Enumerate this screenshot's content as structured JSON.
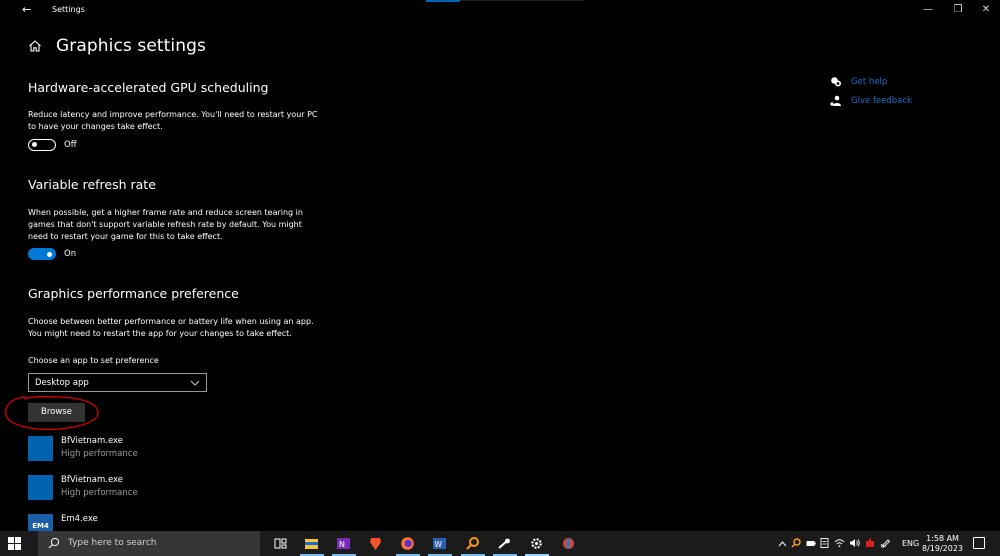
{
  "window": {
    "back_glyph": "←",
    "title": "Settings",
    "controls": {
      "minimize": "—",
      "maximize": "❐",
      "close": "✕"
    }
  },
  "page": {
    "title": "Graphics settings",
    "home_icon": "home-icon"
  },
  "gpu_scheduling": {
    "title": "Hardware-accelerated GPU scheduling",
    "description": "Reduce latency and improve performance. You'll need to restart your PC to have your changes take effect.",
    "toggle_state": "off",
    "toggle_label": "Off"
  },
  "variable_refresh": {
    "title": "Variable refresh rate",
    "description": "When possible, get a higher frame rate and reduce screen tearing in games that don't support variable refresh rate by default. You might need to restart your game for this to take effect.",
    "toggle_state": "on",
    "toggle_label": "On"
  },
  "performance_pref": {
    "title": "Graphics performance preference",
    "description": "Choose between better performance or battery life when using an app. You might need to restart the app for your changes to take effect.",
    "choose_label": "Choose an app to set preference",
    "dropdown_value": "Desktop app",
    "browse_label": "Browse",
    "apps": [
      {
        "name": "BfVietnam.exe",
        "preference": "High performance",
        "icon": "app-icon"
      },
      {
        "name": "BfVietnam.exe",
        "preference": "High performance",
        "icon": "app-icon"
      },
      {
        "name": "Em4.exe",
        "preference": "",
        "icon": "em4-icon",
        "icon_text": "EM4"
      }
    ]
  },
  "help_links": {
    "get_help": "Get help",
    "give_feedback": "Give feedback"
  },
  "taskbar": {
    "search_placeholder": "Type here to search",
    "tray_lang": "ENG",
    "time": "1:58 AM",
    "date": "8/19/2023"
  },
  "colors": {
    "accent": "#0078d7",
    "link": "#1a6ec8",
    "annotation": "#d40000"
  }
}
